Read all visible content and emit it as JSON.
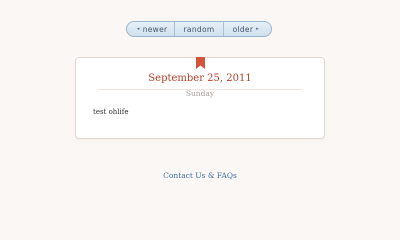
{
  "pager": {
    "newer": {
      "label": "newer",
      "arrow": "◂"
    },
    "random": {
      "label": "random"
    },
    "older": {
      "label": "older",
      "arrow": "▸"
    },
    "bg_color": "#cfe0ee"
  },
  "entry": {
    "date": "September 25, 2011",
    "day": "Sunday",
    "text": "test ohlife",
    "date_color": "#b5402a",
    "bookmark_color": "#d2543a"
  },
  "footer": {
    "contact_label": "Contact Us & FAQs",
    "link_color": "#3b6fa8"
  }
}
